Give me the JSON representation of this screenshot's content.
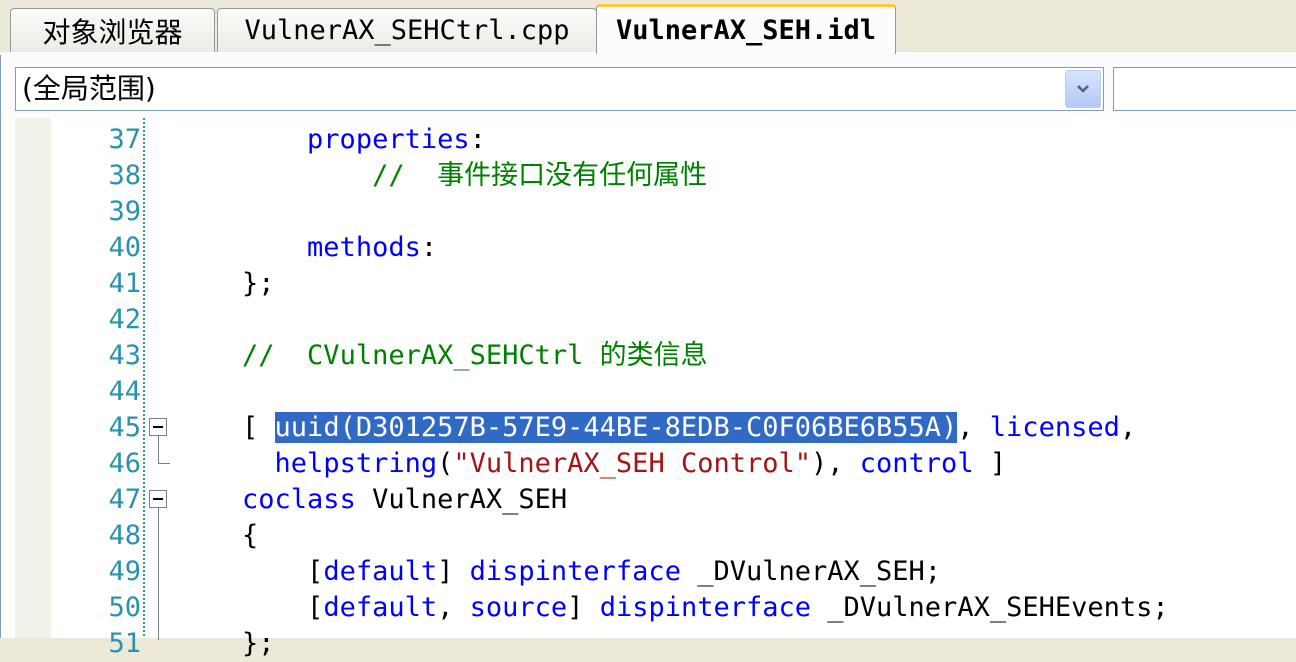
{
  "tabs": [
    {
      "label": "对象浏览器",
      "active": false
    },
    {
      "label": "VulnerAX_SEHCtrl.cpp",
      "active": false
    },
    {
      "label": "VulnerAX_SEH.idl",
      "active": true
    }
  ],
  "scope": {
    "value": "(全局范围)",
    "member_value": ""
  },
  "editor": {
    "lines": [
      {
        "num": "37",
        "indent": "        ",
        "parts": [
          {
            "t": "properties",
            "c": "kw"
          },
          {
            "t": ":",
            "c": ""
          }
        ]
      },
      {
        "num": "38",
        "indent": "            ",
        "parts": [
          {
            "t": "//  ",
            "c": "cm"
          },
          {
            "t": "事件接口没有任何属性",
            "c": "cm cmcn"
          }
        ]
      },
      {
        "num": "39",
        "indent": "",
        "parts": []
      },
      {
        "num": "40",
        "indent": "        ",
        "parts": [
          {
            "t": "methods",
            "c": "kw"
          },
          {
            "t": ":",
            "c": ""
          }
        ]
      },
      {
        "num": "41",
        "indent": "    ",
        "parts": [
          {
            "t": "};",
            "c": ""
          }
        ]
      },
      {
        "num": "42",
        "indent": "",
        "parts": []
      },
      {
        "num": "43",
        "indent": "    ",
        "parts": [
          {
            "t": "//  CVulnerAX_SEHCtrl ",
            "c": "cm"
          },
          {
            "t": "的类信息",
            "c": "cm cmcn"
          }
        ]
      },
      {
        "num": "44",
        "indent": "",
        "parts": []
      },
      {
        "num": "45",
        "indent": "    ",
        "parts": [
          {
            "t": "[ ",
            "c": ""
          },
          {
            "t": "uuid(D301257B-57E9-44BE-8EDB-C0F06BE6B55A)",
            "c": "sel"
          },
          {
            "t": ", ",
            "c": ""
          },
          {
            "t": "licensed",
            "c": "kw"
          },
          {
            "t": ",",
            "c": ""
          }
        ]
      },
      {
        "num": "46",
        "indent": "      ",
        "parts": [
          {
            "t": "helpstring",
            "c": "kw"
          },
          {
            "t": "(",
            "c": ""
          },
          {
            "t": "\"VulnerAX_SEH Control\"",
            "c": "str"
          },
          {
            "t": "), ",
            "c": ""
          },
          {
            "t": "control",
            "c": "kw"
          },
          {
            "t": " ]",
            "c": ""
          }
        ]
      },
      {
        "num": "47",
        "indent": "    ",
        "parts": [
          {
            "t": "coclass",
            "c": "kw"
          },
          {
            "t": " VulnerAX_SEH",
            "c": ""
          }
        ]
      },
      {
        "num": "48",
        "indent": "    ",
        "parts": [
          {
            "t": "{",
            "c": ""
          }
        ]
      },
      {
        "num": "49",
        "indent": "        ",
        "parts": [
          {
            "t": "[",
            "c": ""
          },
          {
            "t": "default",
            "c": "kw"
          },
          {
            "t": "] ",
            "c": ""
          },
          {
            "t": "dispinterface",
            "c": "kw"
          },
          {
            "t": " _DVulnerAX_SEH;",
            "c": ""
          }
        ]
      },
      {
        "num": "50",
        "indent": "        ",
        "parts": [
          {
            "t": "[",
            "c": ""
          },
          {
            "t": "default",
            "c": "kw"
          },
          {
            "t": ", ",
            "c": ""
          },
          {
            "t": "source",
            "c": "kw"
          },
          {
            "t": "] ",
            "c": ""
          },
          {
            "t": "dispinterface",
            "c": "kw"
          },
          {
            "t": " _DVulnerAX_SEHEvents;",
            "c": ""
          }
        ]
      },
      {
        "num": "51",
        "indent": "    ",
        "parts": [
          {
            "t": "};",
            "c": ""
          }
        ]
      }
    ]
  },
  "colors": {
    "keyword": "#0000ff",
    "comment": "#008000",
    "string": "#a31515",
    "line_number": "#2b91af",
    "selection": "#316ac5"
  }
}
